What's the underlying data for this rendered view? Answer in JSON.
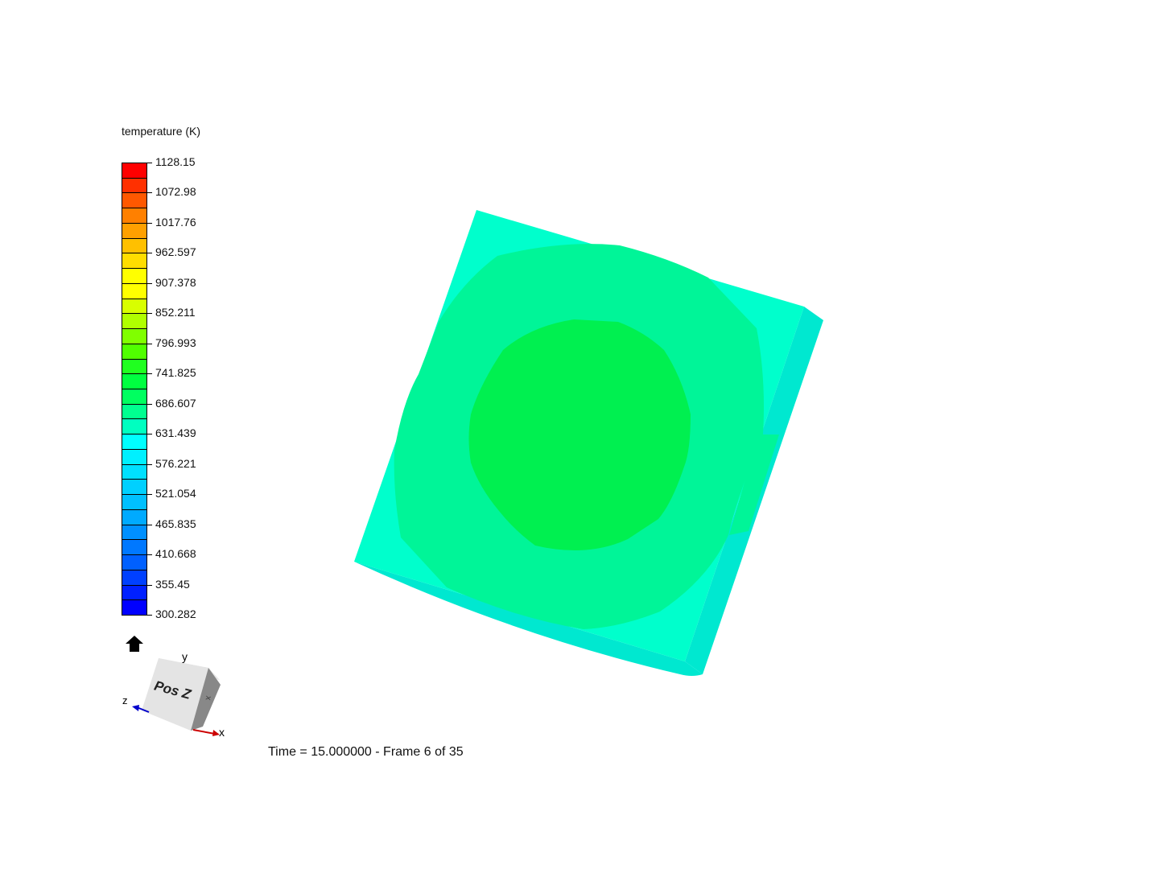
{
  "legend": {
    "title": "temperature (K)",
    "labels": [
      "1128.15",
      "1072.98",
      "1017.76",
      "962.597",
      "907.378",
      "852.211",
      "796.993",
      "741.825",
      "686.607",
      "631.439",
      "576.221",
      "521.054",
      "465.835",
      "410.668",
      "355.45",
      "300.282"
    ],
    "swatch_colors": [
      "#ff0000",
      "#ff3000",
      "#ff5800",
      "#ff8000",
      "#ffa000",
      "#ffc000",
      "#ffdd00",
      "#ffff00",
      "#ffff00",
      "#d8ff00",
      "#b0ff00",
      "#80ff00",
      "#50ff00",
      "#20ff20",
      "#00ff40",
      "#00ff60",
      "#00ff90",
      "#00ffc0",
      "#00ffff",
      "#00f0ff",
      "#00e0ff",
      "#00d0ff",
      "#00c0ff",
      "#00aaff",
      "#0090ff",
      "#0078ff",
      "#0060ff",
      "#0040ff",
      "#0020ff",
      "#0000ff"
    ]
  },
  "model": {
    "outer_color": "#00ffcc",
    "side_color": "#00e8d0",
    "mid_color": "#00f598",
    "core_color": "#00f050"
  },
  "orientation": {
    "face_label": "Pos Z",
    "side_label": "X",
    "axis_x": "x",
    "axis_y": "y",
    "axis_z": "z",
    "x_color": "#cc0000",
    "z_color": "#0000cc",
    "home_icon": "home-icon"
  },
  "status": {
    "time_text": "Time = 15.000000 - Frame 6 of 35"
  }
}
